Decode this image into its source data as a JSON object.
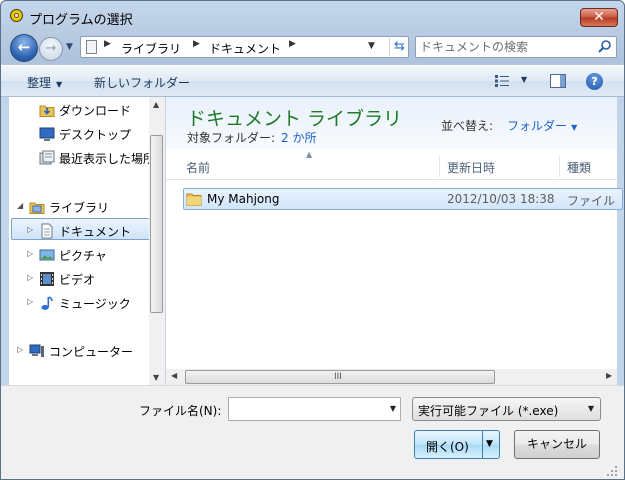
{
  "window": {
    "title": "プログラムの選択",
    "close_label": "✕"
  },
  "address": {
    "segments": [
      "ライブラリ",
      "ドキュメント"
    ]
  },
  "search": {
    "placeholder": "ドキュメントの検索"
  },
  "toolbar": {
    "organize": "整理",
    "new_folder": "新しいフォルダー"
  },
  "sidebar": {
    "items": [
      {
        "label": "ダウンロード",
        "icon": "download-folder-icon"
      },
      {
        "label": "デスクトップ",
        "icon": "desktop-icon"
      },
      {
        "label": "最近表示した場所",
        "icon": "recent-places-icon"
      },
      {
        "label": "ライブラリ",
        "icon": "library-icon"
      },
      {
        "label": "ドキュメント",
        "icon": "documents-icon",
        "selected": true
      },
      {
        "label": "ピクチャ",
        "icon": "pictures-icon"
      },
      {
        "label": "ビデオ",
        "icon": "videos-icon"
      },
      {
        "label": "ミュージック",
        "icon": "music-icon"
      },
      {
        "label": "コンピューター",
        "icon": "computer-icon"
      }
    ]
  },
  "library": {
    "title": "ドキュメント ライブラリ",
    "subtitle_label": "対象フォルダー:",
    "subtitle_link": "2 か所",
    "arrange_label": "並べ替え:",
    "arrange_value": "フォルダー"
  },
  "columns": {
    "name": "名前",
    "date": "更新日時",
    "type": "種類"
  },
  "files": [
    {
      "name": "My Mahjong",
      "date": "2012/10/03 18:38",
      "type": "ファイル"
    }
  ],
  "footer": {
    "filename_label": "ファイル名(N):",
    "filename_value": "",
    "filetype": "実行可能ファイル (*.exe)",
    "open_label": "開く(O)",
    "cancel_label": "キャンセル"
  },
  "colors": {
    "accent_title": "#1e7a28",
    "link": "#1d64c8",
    "selection": "#cfe4fa"
  }
}
